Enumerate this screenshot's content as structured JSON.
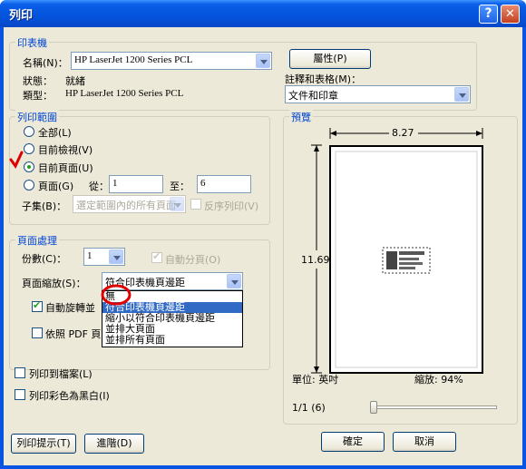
{
  "window": {
    "title": "列印"
  },
  "printer": {
    "legend": "印表機",
    "name_label": "名稱(N)：",
    "name_value": "HP LaserJet 1200 Series PCL",
    "properties_button": "屬性(P)",
    "status_label": "狀態：",
    "status_value": "就緒",
    "type_label": "類型：",
    "type_value": "HP LaserJet 1200 Series PCL",
    "comments_label": "註釋和表格(M)：",
    "comments_value": "文件和印章"
  },
  "print_range": {
    "legend": "列印範圍",
    "all": "全部(L)",
    "current_view": "目前檢視(V)",
    "current_page": "目前頁面(U)",
    "pages": "頁面(G)",
    "from_label": "從：",
    "from_value": "1",
    "to_label": "至：",
    "to_value": "6",
    "subset_label": "子集(B)：",
    "subset_value": "選定範圍內的所有頁面",
    "reverse": "反序列印(V)"
  },
  "page_handling": {
    "legend": "頁面處理",
    "copies_label": "份數(C)：",
    "copies_value": "1",
    "collate": "自動分頁(O)",
    "scaling_label": "頁面縮放(S)：",
    "scaling_value": "符合印表機頁邊距",
    "scaling_options": [
      "無",
      "符合印表機頁邊距",
      "縮小以符合印表機頁邊距",
      "並排大頁面",
      "並排所有頁面"
    ],
    "auto_rotate": "自動旋轉並",
    "pdf_page": "依照 PDF 頁"
  },
  "preview": {
    "legend": "預覽",
    "width": "8.27",
    "height": "11.69",
    "units": "單位: 英吋",
    "zoom": "縮放: 94%",
    "page_indicator": "1/1 (6)"
  },
  "options": {
    "print_to_file": "列印到檔案(L)",
    "print_color_as_black": "列印彩色為黑白(I)"
  },
  "buttons": {
    "tips": "列印提示(T)",
    "advanced": "進階(D)",
    "ok": "確定",
    "cancel": "取消"
  },
  "colors": {
    "titlebar": "#0a54e3",
    "face": "#ece9d8",
    "legend": "#0046d5",
    "selection": "#316ac5",
    "annotation": "#e00000"
  }
}
